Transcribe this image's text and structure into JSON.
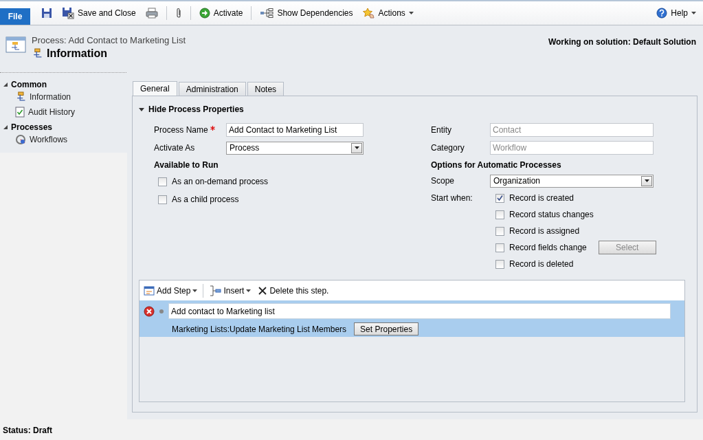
{
  "toolbar": {
    "file_tab": "File",
    "items": [
      {
        "kind": "icon"
      },
      {
        "kind": "button",
        "label": "Save and Close"
      },
      {
        "kind": "icon"
      },
      {
        "kind": "separator"
      },
      {
        "kind": "icon"
      },
      {
        "kind": "separator"
      },
      {
        "kind": "button",
        "label": "Activate"
      },
      {
        "kind": "separator"
      },
      {
        "kind": "button",
        "label": "Show Dependencies"
      },
      {
        "kind": "menu",
        "label": "Actions"
      }
    ],
    "help": "Help"
  },
  "header": {
    "breadcrumb": "Process: Add Contact to Marketing List",
    "title": "Information",
    "solution": "Working on solution: Default Solution"
  },
  "sidebar": {
    "groups": [
      {
        "title": "Common",
        "expanded": true,
        "items": [
          {
            "label": "Information"
          },
          {
            "label": "Audit History"
          }
        ]
      },
      {
        "title": "Processes",
        "expanded": true,
        "items": [
          {
            "label": "Workflows"
          }
        ]
      }
    ]
  },
  "tabs": [
    {
      "label": "General",
      "selected": true
    },
    {
      "label": "Administration",
      "selected": false
    },
    {
      "label": "Notes",
      "selected": false
    }
  ],
  "section": {
    "title": "Hide Process Properties",
    "expanded": true
  },
  "left": {
    "process_name": {
      "label": "Process Name",
      "required": true,
      "value": "Add Contact to Marketing List"
    },
    "activate_as": {
      "label": "Activate As",
      "value": "Process"
    },
    "available_to_run": {
      "title": "Available to Run",
      "options": [
        {
          "label": "As an on-demand process",
          "checked": false
        },
        {
          "label": "As a child process",
          "checked": false
        }
      ]
    }
  },
  "right": {
    "entity": {
      "label": "Entity",
      "value": "Contact",
      "disabled": true
    },
    "category": {
      "label": "Category",
      "value": "Workflow",
      "disabled": true
    },
    "options_title": "Options for Automatic Processes",
    "scope": {
      "label": "Scope",
      "value": "Organization"
    },
    "start_when": {
      "label": "Start when:",
      "options": [
        {
          "label": "Record is created",
          "checked": true
        },
        {
          "label": "Record status changes",
          "checked": false
        },
        {
          "label": "Record is assigned",
          "checked": false
        },
        {
          "label": "Record fields change",
          "checked": false,
          "button": "Select",
          "button_disabled": true
        },
        {
          "label": "Record is deleted",
          "checked": false
        }
      ]
    }
  },
  "steps": {
    "toolbar": [
      {
        "label": "Add Step",
        "dropdown": true
      },
      {
        "label": "Insert",
        "dropdown": true
      },
      {
        "label": "Delete this step.",
        "dropdown": false
      }
    ],
    "items": [
      {
        "title": "Add contact to Marketing list",
        "description": "Marketing Lists:Update Marketing List Members",
        "button": "Set Properties",
        "error": true,
        "selected": true
      }
    ]
  },
  "status_bar": "Status: Draft"
}
